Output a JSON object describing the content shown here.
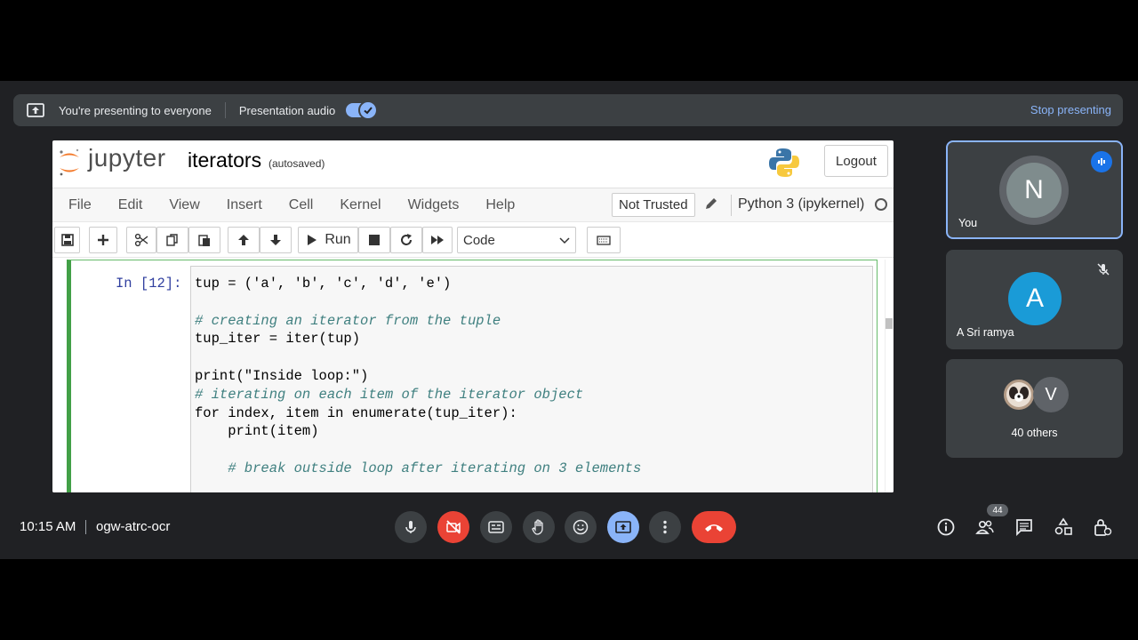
{
  "banner": {
    "presenting_text": "You're presenting to everyone",
    "audio_label": "Presentation audio",
    "stop_label": "Stop presenting"
  },
  "jupyter": {
    "brand": "jupyter",
    "notebook_name": "iterators",
    "autosaved": "(autosaved)",
    "logout": "Logout",
    "menu": [
      "File",
      "Edit",
      "View",
      "Insert",
      "Cell",
      "Kernel",
      "Widgets",
      "Help"
    ],
    "trust": "Not Trusted",
    "kernel": "Python 3 (ipykernel)",
    "run_label": "Run",
    "cell_type": "Code",
    "cell_prompt": "In [12]:"
  },
  "code_lines": [
    "tup = ('a', 'b', 'c', 'd', 'e')",
    "",
    "# creating an iterator from the tuple",
    "tup_iter = iter(tup)",
    "",
    "print(\"Inside loop:\")",
    "# iterating on each item of the iterator object",
    "for index, item in enumerate(tup_iter):",
    "    print(item)",
    "",
    "    # break outside loop after iterating on 3 elements"
  ],
  "participants": {
    "you": {
      "initial": "N",
      "name": "You"
    },
    "sri": {
      "initial": "A",
      "name": "A Sri ramya"
    },
    "others": {
      "initial": "V",
      "label": "40 others"
    }
  },
  "bottom": {
    "time": "10:15 AM",
    "meeting": "ogw-atrc-ocr",
    "people_count": "44"
  },
  "colors": {
    "accent": "#8ab4f8",
    "danger": "#ea4335",
    "sri_avatar": "#1a9bd7",
    "you_avatar": "#7f8c8d"
  }
}
